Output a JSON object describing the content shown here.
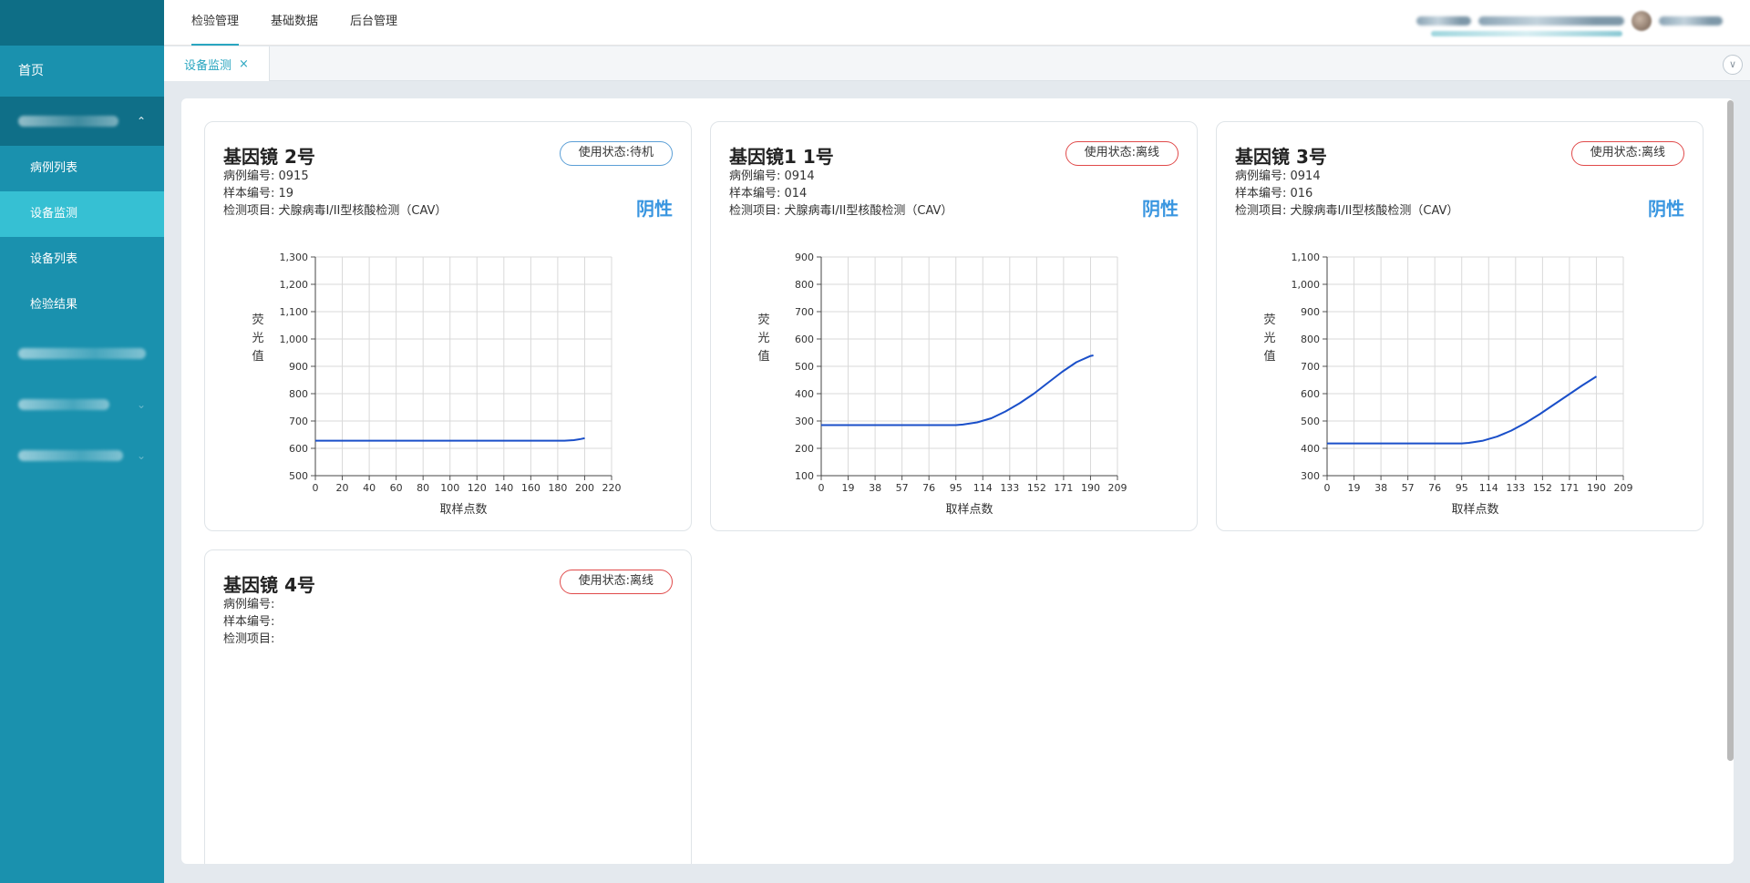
{
  "colors": {
    "sidebar": "#1a91ae",
    "sidebar_active": "#36c0d3",
    "accent": "#2aa6c0",
    "offline": "#e04a4a",
    "standby": "#5b9fd6",
    "negative": "#3a96e0",
    "line": "#1a4fc9"
  },
  "sidebar": {
    "home": "首页",
    "group_expand_icon": "chevron-up-icon",
    "items": [
      {
        "label": "病例列表"
      },
      {
        "label": "设备监测",
        "active": true
      },
      {
        "label": "设备列表"
      },
      {
        "label": "检验结果"
      }
    ]
  },
  "topnav": {
    "items": [
      "检验管理",
      "基础数据",
      "后台管理"
    ],
    "active_index": 0
  },
  "tabs": [
    {
      "label": "设备监测",
      "close": "×"
    }
  ],
  "collapse_icon": "chevron-down-circle-icon",
  "labels": {
    "case_no": "病例编号:",
    "sample_no": "样本编号:",
    "test_item": "检测项目:"
  },
  "cards": [
    {
      "title": "基因镜 2号",
      "status": "使用状态:待机",
      "status_type": "standby",
      "case_no": "0915",
      "sample_no": "19",
      "test_item": "犬腺病毒I/II型核酸检测（CAV）",
      "result": "阴性",
      "chart_data": {
        "type": "line",
        "xlabel": "取样点数",
        "ylabel": "荧光值",
        "xticks": [
          0,
          20,
          40,
          60,
          80,
          100,
          120,
          140,
          160,
          180,
          200,
          220
        ],
        "yticks": [
          500,
          600,
          700,
          800,
          900,
          1000,
          1100,
          1200,
          1300
        ],
        "xlim": [
          0,
          220
        ],
        "ylim": [
          500,
          1300
        ],
        "series": [
          {
            "x": [
              0,
              50,
              100,
              150,
              185,
              192,
              197,
              200
            ],
            "y": [
              628,
              628,
              628,
              628,
              628,
              630,
              634,
              637
            ]
          }
        ]
      }
    },
    {
      "title": "基因镜1 1号",
      "status": "使用状态:离线",
      "status_type": "offline",
      "case_no": "0914",
      "sample_no": "014",
      "test_item": "犬腺病毒I/II型核酸检测（CAV）",
      "result": "阴性",
      "chart_data": {
        "type": "line",
        "xlabel": "取样点数",
        "ylabel": "荧光值",
        "xticks": [
          0,
          19,
          38,
          57,
          76,
          95,
          114,
          133,
          152,
          171,
          190,
          209
        ],
        "yticks": [
          100,
          200,
          300,
          400,
          500,
          600,
          700,
          800,
          900
        ],
        "xlim": [
          0,
          209
        ],
        "ylim": [
          100,
          900
        ],
        "series": [
          {
            "x": [
              0,
              40,
              80,
              95,
              100,
              110,
              120,
              130,
              140,
              150,
              160,
              170,
              180,
              190,
              192
            ],
            "y": [
              285,
              285,
              285,
              285,
              287,
              295,
              310,
              335,
              365,
              400,
              440,
              480,
              515,
              538,
              540
            ]
          }
        ]
      }
    },
    {
      "title": "基因镜 3号",
      "status": "使用状态:离线",
      "status_type": "offline",
      "case_no": "0914",
      "sample_no": "016",
      "test_item": "犬腺病毒I/II型核酸检测（CAV）",
      "result": "阴性",
      "chart_data": {
        "type": "line",
        "xlabel": "取样点数",
        "ylabel": "荧光值",
        "xticks": [
          0,
          19,
          38,
          57,
          76,
          95,
          114,
          133,
          152,
          171,
          190,
          209
        ],
        "yticks": [
          300,
          400,
          500,
          600,
          700,
          800,
          900,
          1000,
          1100
        ],
        "xlim": [
          0,
          209
        ],
        "ylim": [
          300,
          1100
        ],
        "series": [
          {
            "x": [
              0,
              40,
              80,
              95,
              100,
              110,
              120,
              130,
              140,
              150,
              160,
              170,
              180,
              190
            ],
            "y": [
              418,
              418,
              418,
              418,
              420,
              428,
              443,
              465,
              493,
              525,
              560,
              595,
              630,
              663
            ]
          }
        ]
      }
    },
    {
      "title": "基因镜 4号",
      "status": "使用状态:离线",
      "status_type": "offline",
      "case_no": "",
      "sample_no": "",
      "test_item": "",
      "result": "",
      "chart_data": null
    }
  ]
}
